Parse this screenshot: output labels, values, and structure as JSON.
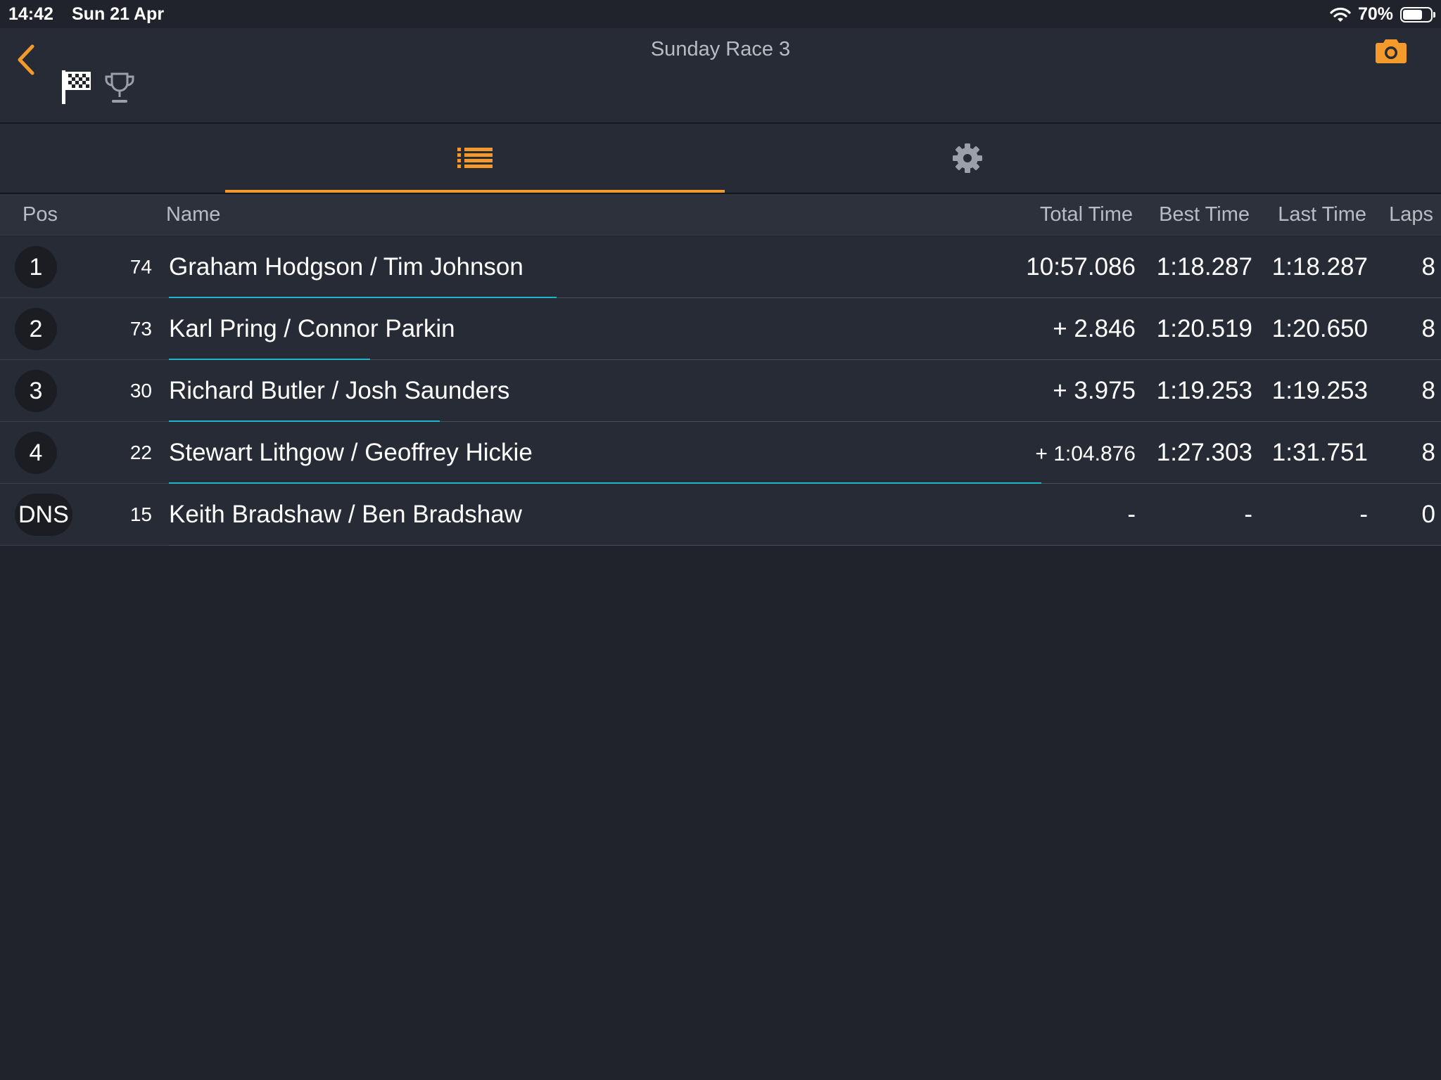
{
  "status_bar": {
    "time": "14:42",
    "date": "Sun 21 Apr",
    "battery_percent": "70%",
    "battery_level": 0.7
  },
  "header": {
    "title": "Sunday Race 3",
    "back_icon": "chevron-left-icon",
    "camera_icon": "camera-icon",
    "accent_color": "#f39a2b"
  },
  "tabs": [
    {
      "icon": "list-icon",
      "active": true
    },
    {
      "icon": "gear-icon",
      "active": false
    }
  ],
  "columns": {
    "pos": "Pos",
    "name": "Name",
    "total_time": "Total Time",
    "best_time": "Best Time",
    "last_time": "Last Time",
    "laps": "Laps"
  },
  "progress_color": "#1fb7c8",
  "results": [
    {
      "pos": "1",
      "kart": "74",
      "name": "Graham Hodgson / Tim Johnson",
      "total": "10:57.086",
      "best": "1:18.287",
      "last": "1:18.287",
      "laps": "8",
      "progress": 0.305
    },
    {
      "pos": "2",
      "kart": "73",
      "name": "Karl Pring / Connor Parkin",
      "total": "+ 2.846",
      "best": "1:20.519",
      "last": "1:20.650",
      "laps": "8",
      "progress": 0.158
    },
    {
      "pos": "3",
      "kart": "30",
      "name": "Richard Butler / Josh Saunders",
      "total": "+ 3.975",
      "best": "1:19.253",
      "last": "1:19.253",
      "laps": "8",
      "progress": 0.213
    },
    {
      "pos": "4",
      "kart": "22",
      "name": "Stewart Lithgow / Geoffrey Hickie",
      "total": "+ 1:04.876",
      "best": "1:27.303",
      "last": "1:31.751",
      "laps": "8",
      "progress": 0.686
    },
    {
      "pos": "DNS",
      "kart": "15",
      "name": "Keith Bradshaw / Ben Bradshaw",
      "total": "-",
      "best": "-",
      "last": "-",
      "laps": "0",
      "progress": 0
    }
  ]
}
